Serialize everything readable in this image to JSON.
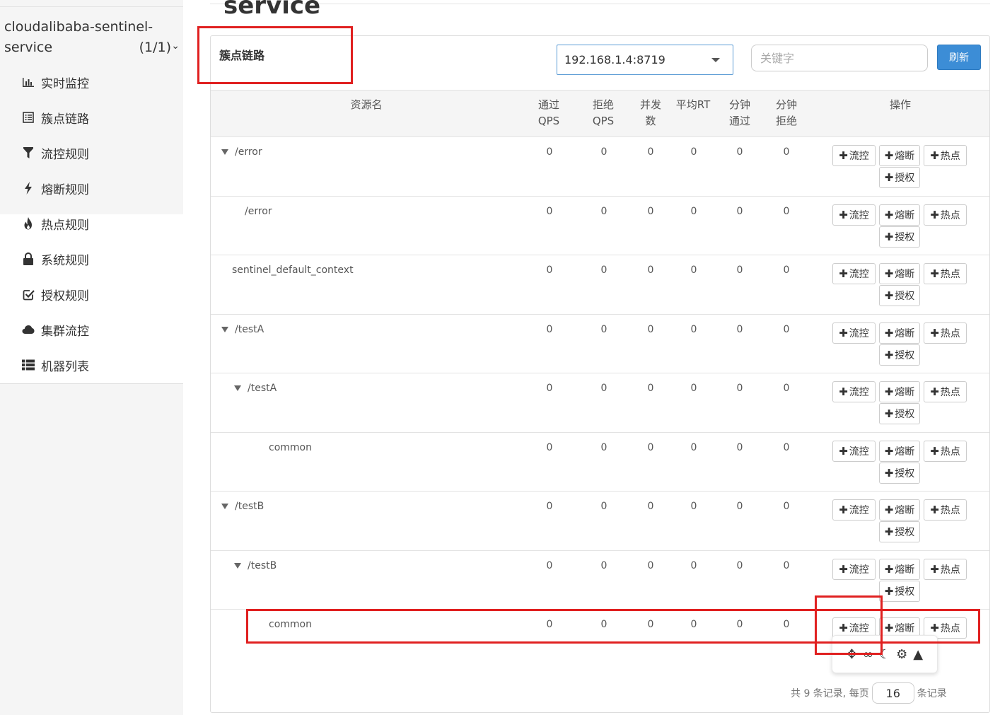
{
  "sidebar": {
    "app_name": "cloudalibaba-sentinel-service",
    "app_count": "(1/1)",
    "items": [
      {
        "label": "实时监控",
        "icon": "bar-chart-icon"
      },
      {
        "label": "簇点链路",
        "icon": "list-icon"
      },
      {
        "label": "流控规则",
        "icon": "filter-icon"
      },
      {
        "label": "熔断规则",
        "icon": "bolt-icon"
      },
      {
        "label": "热点规则",
        "icon": "fire-icon"
      },
      {
        "label": "系统规则",
        "icon": "lock-icon"
      },
      {
        "label": "授权规则",
        "icon": "check-square-icon"
      },
      {
        "label": "集群流控",
        "icon": "cloud-icon"
      },
      {
        "label": "机器列表",
        "icon": "th-list-icon"
      }
    ]
  },
  "header": {
    "title": "service"
  },
  "panel": {
    "title": "簇点链路",
    "machine": "192.168.1.4:8719",
    "keyword_placeholder": "关键字",
    "refresh_label": "刷新"
  },
  "table": {
    "headers": {
      "resource": "资源名",
      "pass_qps": "通过QPS",
      "block_qps": "拒绝QPS",
      "concurrency": "并发数",
      "avg_rt": "平均RT",
      "minute_pass": "分钟通过",
      "minute_block": "分钟拒绝",
      "ops": "操作"
    },
    "op_labels": {
      "flow": "流控",
      "degrade": "熔断",
      "hot": "热点",
      "auth": "授权"
    },
    "rows": [
      {
        "name": "/error",
        "level": 0,
        "toggle": true,
        "values": [
          "0",
          "0",
          "0",
          "0",
          "0",
          "0"
        ]
      },
      {
        "name": "/error",
        "level": 1,
        "toggle": false,
        "values": [
          "0",
          "0",
          "0",
          "0",
          "0",
          "0"
        ]
      },
      {
        "name": "sentinel_default_context",
        "level": 0,
        "toggle": false,
        "values": [
          "0",
          "0",
          "0",
          "0",
          "0",
          "0"
        ]
      },
      {
        "name": "/testA",
        "level": 0,
        "toggle": true,
        "values": [
          "0",
          "0",
          "0",
          "0",
          "0",
          "0"
        ]
      },
      {
        "name": "/testA",
        "level": 1,
        "toggle": true,
        "values": [
          "0",
          "0",
          "0",
          "0",
          "0",
          "0"
        ]
      },
      {
        "name": "common",
        "level": 2,
        "toggle": false,
        "values": [
          "0",
          "0",
          "0",
          "0",
          "0",
          "0"
        ]
      },
      {
        "name": "/testB",
        "level": 0,
        "toggle": true,
        "values": [
          "0",
          "0",
          "0",
          "0",
          "0",
          "0"
        ]
      },
      {
        "name": "/testB",
        "level": 1,
        "toggle": true,
        "values": [
          "0",
          "0",
          "0",
          "0",
          "0",
          "0"
        ]
      },
      {
        "name": "common",
        "level": 2,
        "toggle": false,
        "values": [
          "0",
          "0",
          "0",
          "0",
          "0",
          "0"
        ]
      }
    ]
  },
  "pagination": {
    "prefix": "共 9 条记录, 每页",
    "page_size": "16",
    "suffix": "条记录"
  },
  "colors": {
    "accent": "#3c8dd6",
    "annotation": "#e02020"
  }
}
